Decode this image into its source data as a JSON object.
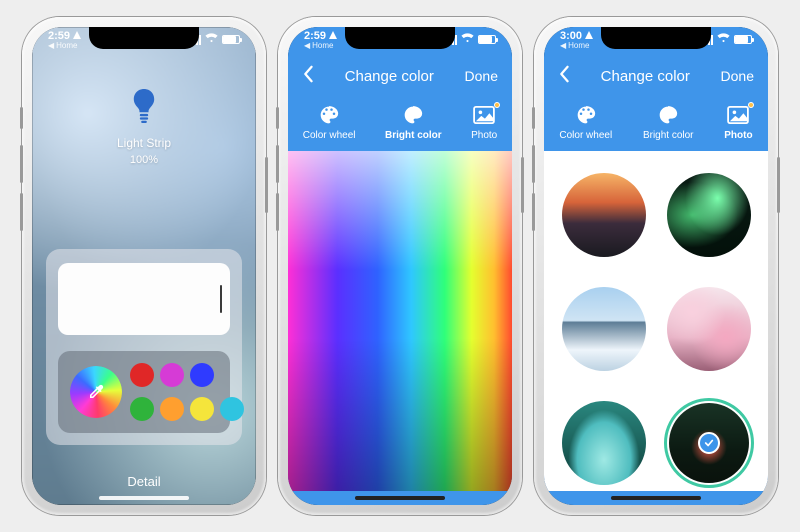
{
  "phone1": {
    "status": {
      "time": "2:59",
      "breadcrumb": "Home"
    },
    "device": {
      "name": "Light Strip",
      "brightness": "100%"
    },
    "swatches": [
      "#e02727",
      "#d63bd6",
      "#2f3bff",
      "#2fb33b",
      "#ff9f2f",
      "#f5e53b",
      "#2fc4e0"
    ],
    "detail_label": "Detail"
  },
  "phone2": {
    "status": {
      "time": "2:59",
      "breadcrumb": "Home"
    },
    "nav": {
      "title": "Change color",
      "done": "Done"
    },
    "tabs": {
      "wheel": "Color wheel",
      "bright": "Bright color",
      "photo": "Photo",
      "selected": "bright"
    }
  },
  "phone3": {
    "status": {
      "time": "3:00",
      "breadcrumb": "Home"
    },
    "nav": {
      "title": "Change color",
      "done": "Done"
    },
    "tabs": {
      "wheel": "Color wheel",
      "bright": "Bright color",
      "photo": "Photo",
      "selected": "photo"
    },
    "photos": [
      "sunset",
      "aurora",
      "mountain",
      "blossom",
      "lagoon",
      "city"
    ],
    "selected_photo": "city"
  }
}
